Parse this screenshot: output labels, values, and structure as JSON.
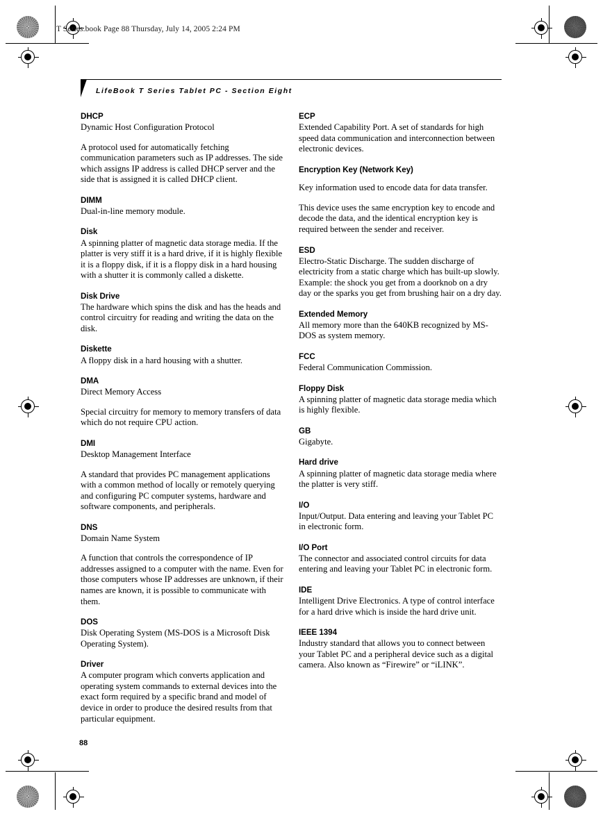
{
  "document": {
    "file_stamp": "T Series.book  Page 88  Thursday, July 14, 2005  2:24 PM",
    "section_header": "LifeBook T Series Tablet PC - Section Eight",
    "page_number": "88"
  },
  "glossary": {
    "left_column": [
      {
        "term": "DHCP",
        "blocks": [
          {
            "style": "tight",
            "text": "Dynamic Host Configuration Protocol"
          },
          {
            "style": "gap",
            "text": "A protocol used for automatically fetching communication parameters such as IP addresses. The side which assigns IP address is called DHCP server and the side that is assigned it is called DHCP client."
          }
        ]
      },
      {
        "term": "DIMM",
        "blocks": [
          {
            "style": "tight",
            "text": "Dual-in-line memory module."
          }
        ]
      },
      {
        "term": "Disk",
        "blocks": [
          {
            "style": "tight",
            "text": "A spinning platter of magnetic data storage media. If the platter is very stiff it is a hard drive, if it is highly flexible it is a floppy disk, if it is a floppy disk in a hard housing with a shutter it is commonly called a diskette."
          }
        ]
      },
      {
        "term": "Disk Drive",
        "blocks": [
          {
            "style": "tight",
            "text": "The hardware which spins the disk and has the heads and control circuitry for reading and writing the data on the disk."
          }
        ]
      },
      {
        "term": "Diskette",
        "blocks": [
          {
            "style": "tight",
            "text": "A floppy disk in a hard housing with a shutter."
          }
        ]
      },
      {
        "term": "DMA",
        "blocks": [
          {
            "style": "tight",
            "text": "Direct Memory Access"
          },
          {
            "style": "gap",
            "text": "Special circuitry for memory to memory transfers of data which do not require CPU action."
          }
        ]
      },
      {
        "term": "DMI",
        "blocks": [
          {
            "style": "tight",
            "text": "Desktop Management Interface"
          },
          {
            "style": "gap",
            "text": "A standard that provides PC management applications with a common method of locally or remotely querying and configuring PC computer systems, hardware and software components, and peripherals."
          }
        ]
      },
      {
        "term": "DNS",
        "blocks": [
          {
            "style": "tight",
            "text": "Domain Name System"
          },
          {
            "style": "gap",
            "text": "A function that controls the correspondence of IP addresses assigned to a computer with the name. Even for those computers whose IP addresses are unknown, if their names are known, it is possible to communicate with them."
          }
        ]
      },
      {
        "term": "DOS",
        "blocks": [
          {
            "style": "tight",
            "text": "Disk Operating System (MS-DOS is a Microsoft Disk Operating System)."
          }
        ]
      },
      {
        "term": "Driver",
        "blocks": [
          {
            "style": "tight",
            "text": "A computer program which converts application and operating system commands to external devices into the exact form required by a specific brand and model of device in order to produce the desired results from that particular equipment."
          }
        ]
      }
    ],
    "right_column": [
      {
        "term": "ECP",
        "blocks": [
          {
            "style": "tight",
            "text": "Extended Capability Port. A set of standards for high speed data communication and interconnection between electronic devices."
          }
        ]
      },
      {
        "term": "Encryption Key (Network Key)",
        "blocks": [
          {
            "style": "gap-small",
            "text": "Key information used to encode data for data transfer."
          },
          {
            "style": "gap",
            "text": "This device uses the same encryption key to encode and decode the data, and the identical encryption key is required between the sender and receiver."
          }
        ]
      },
      {
        "term": "ESD",
        "blocks": [
          {
            "style": "tight",
            "text": "Electro-Static Discharge. The sudden discharge of electricity from a static charge which has built-up slowly. Example: the shock you get from a doorknob on a dry day or the sparks you get from brushing hair on a dry day."
          }
        ]
      },
      {
        "term": "Extended Memory",
        "blocks": [
          {
            "style": "tight",
            "text": "All memory more than the 640KB recognized by MS-DOS as system memory."
          }
        ]
      },
      {
        "term": "FCC",
        "blocks": [
          {
            "style": "tight",
            "text": "Federal Communication Commission."
          }
        ]
      },
      {
        "term": "Floppy Disk",
        "blocks": [
          {
            "style": "tight",
            "text": "A spinning platter of magnetic data storage media which is highly flexible."
          }
        ]
      },
      {
        "term": "GB",
        "blocks": [
          {
            "style": "tight",
            "text": "Gigabyte."
          }
        ]
      },
      {
        "term": "Hard drive",
        "blocks": [
          {
            "style": "tight",
            "text": "A spinning platter of magnetic data storage media where the platter is very stiff."
          }
        ]
      },
      {
        "term": "I/O",
        "blocks": [
          {
            "style": "tight",
            "text": "Input/Output. Data entering and leaving your Tablet PC in electronic form."
          }
        ]
      },
      {
        "term": "I/O Port",
        "blocks": [
          {
            "style": "tight",
            "text": "The connector and associated control circuits for data entering and leaving your Tablet PC in electronic form."
          }
        ]
      },
      {
        "term": "IDE",
        "blocks": [
          {
            "style": "tight",
            "text": "Intelligent Drive Electronics. A type of control interface for a hard drive which is inside the hard drive unit."
          }
        ]
      },
      {
        "term": "IEEE 1394",
        "blocks": [
          {
            "style": "tight",
            "text": "Industry standard that allows you to connect between your Tablet PC and a peripheral device such as a digital camera. Also known as “Firewire” or “iLINK”."
          }
        ]
      }
    ]
  },
  "print_marks": {
    "registration_target": "registration-target-icon",
    "density_patch": "density-patch-icon"
  }
}
